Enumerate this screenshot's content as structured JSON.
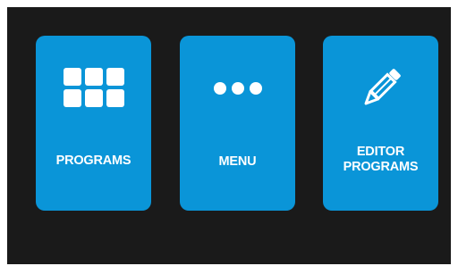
{
  "tiles": [
    {
      "label": "PROGRAMS",
      "icon": "grid-icon"
    },
    {
      "label": "MENU",
      "icon": "more-dots-icon"
    },
    {
      "label": "EDITOR\nPROGRAMS",
      "icon": "pencil-icon"
    }
  ],
  "colors": {
    "background": "#1a1a1a",
    "tile": "#0a95d8",
    "text": "#ffffff"
  }
}
